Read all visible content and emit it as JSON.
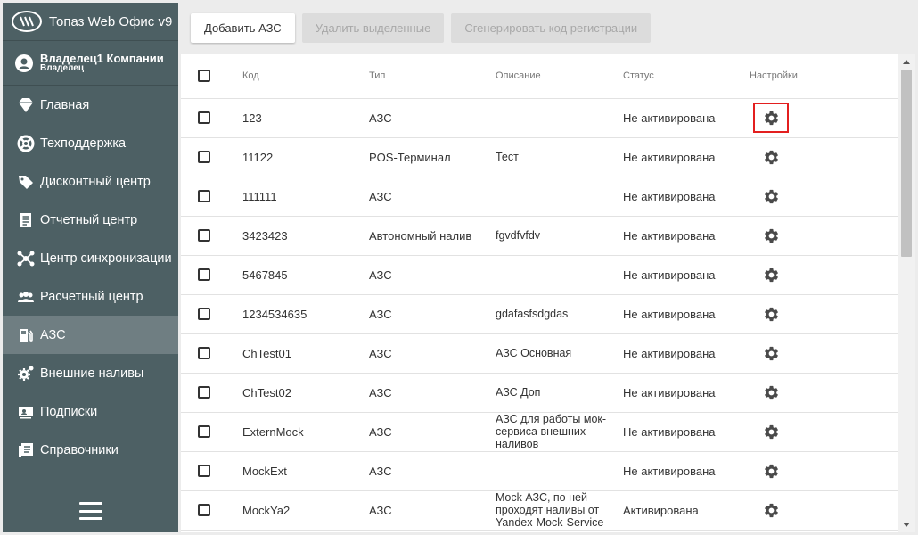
{
  "app": {
    "title": "Топаз Web Офис v9"
  },
  "user": {
    "name": "Владелец1 Компании",
    "role": "Владелец"
  },
  "nav": {
    "items": [
      {
        "label": "Главная",
        "icon": "diamond-icon"
      },
      {
        "label": "Техподдержка",
        "icon": "lifebuoy-icon"
      },
      {
        "label": "Дисконтный центр",
        "icon": "tag-icon"
      },
      {
        "label": "Отчетный центр",
        "icon": "report-icon"
      },
      {
        "label": "Центр синхронизации",
        "icon": "sync-icon"
      },
      {
        "label": "Расчетный центр",
        "icon": "users-icon"
      },
      {
        "label": "АЗС",
        "icon": "fuel-icon",
        "active": true
      },
      {
        "label": "Внешние наливы",
        "icon": "gears-icon"
      },
      {
        "label": "Подписки",
        "icon": "subscription-icon"
      },
      {
        "label": "Справочники",
        "icon": "book-icon"
      }
    ]
  },
  "toolbar": {
    "add_label": "Добавить АЗС",
    "delete_label": "Удалить выделенные",
    "generate_label": "Сгенерировать код регистрации"
  },
  "table": {
    "headers": {
      "code": "Код",
      "type": "Тип",
      "description": "Описание",
      "status": "Статус",
      "settings": "Настройки"
    },
    "rows": [
      {
        "code": "123",
        "type": "АЗС",
        "description": "",
        "status": "Не активирована"
      },
      {
        "code": "11122",
        "type": "POS-Терминал",
        "description": "Тест",
        "status": "Не активирована"
      },
      {
        "code": "111111",
        "type": "АЗС",
        "description": "",
        "status": "Не активирована"
      },
      {
        "code": "3423423",
        "type": "Автономный налив",
        "description": "fgvdfvfdv",
        "status": "Не активирована"
      },
      {
        "code": "5467845",
        "type": "АЗС",
        "description": "",
        "status": "Не активирована"
      },
      {
        "code": "1234534635",
        "type": "АЗС",
        "description": "gdafasfsdgdas",
        "status": "Не активирована"
      },
      {
        "code": "ChTest01",
        "type": "АЗС",
        "description": "АЗС Основная",
        "status": "Не активирована"
      },
      {
        "code": "ChTest02",
        "type": "АЗС",
        "description": "АЗС Доп",
        "status": "Не активирована"
      },
      {
        "code": "ExternMock",
        "type": "АЗС",
        "description": "АЗС для работы мок-сервиса внешних наливов",
        "status": "Не активирована"
      },
      {
        "code": "MockExt",
        "type": "АЗС",
        "description": "",
        "status": "Не активирована"
      },
      {
        "code": "MockYa2",
        "type": "АЗС",
        "description": "Mock АЗС, по ней проходят наливы от Yandex-Mock-Service",
        "status": "Активирована"
      }
    ],
    "highlight_color": "#e31f1f"
  }
}
